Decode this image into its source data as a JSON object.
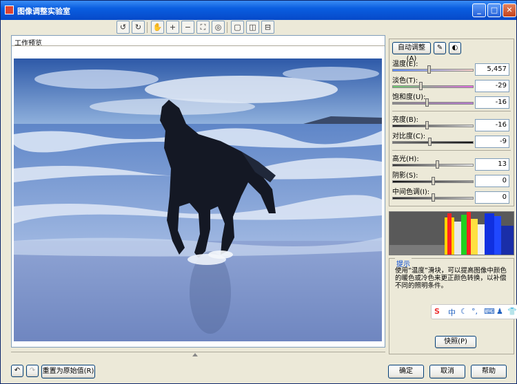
{
  "window": {
    "title": "图像调整实验室"
  },
  "toolbar": {
    "icons": [
      "rotate-left",
      "rotate-right",
      "hand",
      "zoom-in",
      "zoom-out",
      "fit",
      "actual-size",
      "single-view",
      "split-view-vertical",
      "split-view-horizontal"
    ]
  },
  "preview": {
    "label": "工作预览",
    "image": "black horse galloping on beach"
  },
  "controls": {
    "auto_adjust": "自动调整(A)",
    "sliders": [
      {
        "label": "温度(E):",
        "value": "5,457",
        "fraction": 0.45
      },
      {
        "label": "淡色(T):",
        "value": "-29",
        "fraction": 0.34
      },
      {
        "label": "饱和度(U):",
        "value": "-16",
        "fraction": 0.42
      },
      {
        "label": "亮度(B):",
        "value": "-16",
        "fraction": 0.42
      },
      {
        "label": "对比度(C):",
        "value": "-9",
        "fraction": 0.46
      },
      {
        "label": "高光(H):",
        "value": "13",
        "fraction": 0.56
      },
      {
        "label": "阴影(S):",
        "value": "0",
        "fraction": 0.5
      },
      {
        "label": "中间色调(I):",
        "value": "0",
        "fraction": 0.5
      }
    ]
  },
  "tips": {
    "legend": "提示",
    "text": "使用“温度”滑块，可以提高图像中颜色的暖色或冷色来更正颜色转换，以补偿不同的照明条件。",
    "snapshot_button": "快照(P)"
  },
  "footer": {
    "reset_button": "重置为原始值(R)",
    "ok_button": "确定",
    "cancel_button": "取消",
    "help_button": "帮助"
  },
  "ime": {
    "label": "中"
  },
  "colors": {
    "title_bar": "#0a5ee0",
    "window_bg": "#ece9d8",
    "accent_border": "#003c74"
  }
}
